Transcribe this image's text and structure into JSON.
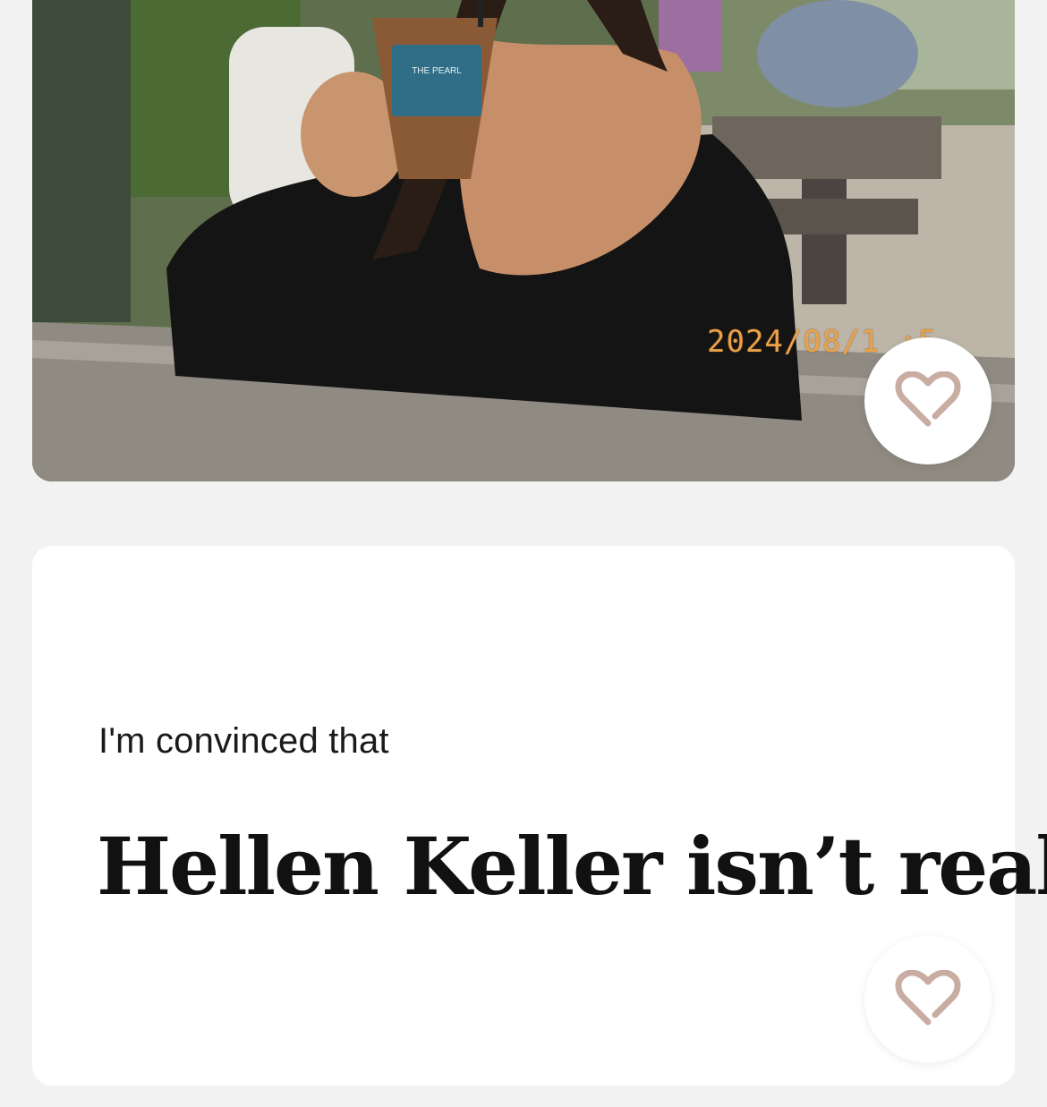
{
  "photo": {
    "timestamp_overlay": "2024/08/1   :5",
    "cup_brand": "THE PEARL",
    "like_icon": "heart-icon"
  },
  "prompt": {
    "question": "I'm convinced that",
    "answer": "Hellen Keller isn’t real",
    "like_icon": "heart-icon"
  },
  "colors": {
    "background": "#f2f2f2",
    "card": "#ffffff",
    "heart": "#c9ada3",
    "timestamp": "#e9a24a"
  }
}
